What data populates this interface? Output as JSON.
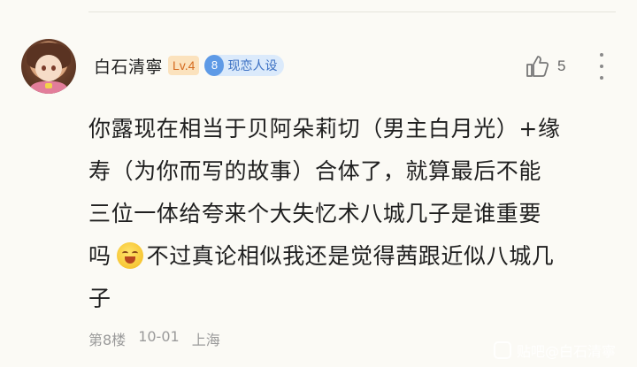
{
  "comment": {
    "username": "白石清寧",
    "level": "Lv.4",
    "medal": {
      "number": "8",
      "label": "现恋人设"
    },
    "likes": "5",
    "text_lines": [
      "你露现在相当于贝阿朵莉切（男主白月光）+缘",
      "寿（为你而写的故事）合体了，就算最后不能",
      "三位一体给夸来个大失忆术八城几子是谁重要",
      "不过真论相似我还是觉得茜跟近似八城几",
      "子"
    ],
    "line4_prefix": "吗",
    "floor": "第8楼",
    "date": "10-01",
    "location": "上海"
  },
  "watermark": "贴吧@白石清寧",
  "colors": {
    "background": "#fbfaf5",
    "level_badge_bg": "#fbe2bd",
    "level_badge_text": "#d46a1f",
    "medal_bg": "#dbeafb",
    "medal_accent": "#5e9ae6"
  },
  "icons": [
    "avatar",
    "thumbs-up-icon",
    "more-vertical-icon",
    "grin-emoji-icon"
  ]
}
